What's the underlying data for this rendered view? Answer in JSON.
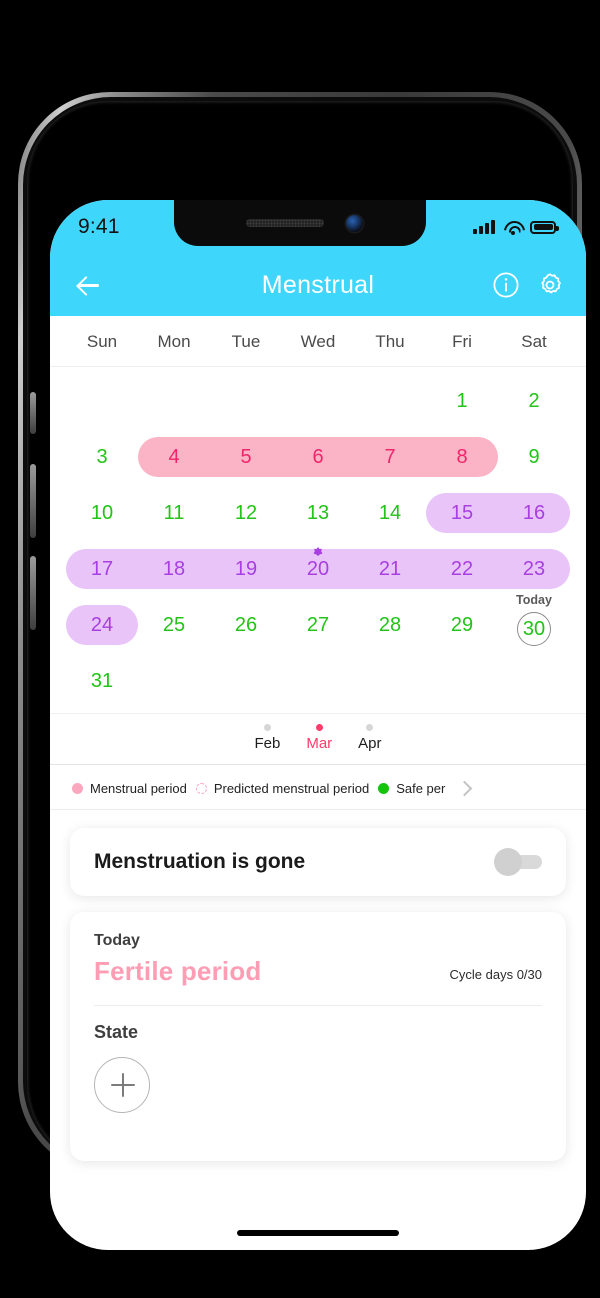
{
  "status_bar": {
    "time": "9:41",
    "signal_icon": "cellular-bars-icon",
    "wifi_icon": "wifi-icon",
    "battery_icon": "battery-icon"
  },
  "header": {
    "title": "Menstrual",
    "back_icon": "back-arrow-icon",
    "info_icon": "info-circle-icon",
    "settings_icon": "gear-icon",
    "background_color": "#3ED7FB"
  },
  "calendar": {
    "weekdays": [
      "Sun",
      "Mon",
      "Tue",
      "Wed",
      "Thu",
      "Fri",
      "Sat"
    ],
    "today_label": "Today",
    "weeks": [
      [
        {
          "day": "",
          "type": "empty"
        },
        {
          "day": "",
          "type": "empty"
        },
        {
          "day": "",
          "type": "empty"
        },
        {
          "day": "",
          "type": "empty"
        },
        {
          "day": "",
          "type": "empty"
        },
        {
          "day": "1",
          "type": "safe"
        },
        {
          "day": "2",
          "type": "safe"
        }
      ],
      [
        {
          "day": "3",
          "type": "safe"
        },
        {
          "day": "4",
          "type": "menses"
        },
        {
          "day": "5",
          "type": "menses"
        },
        {
          "day": "6",
          "type": "menses"
        },
        {
          "day": "7",
          "type": "menses"
        },
        {
          "day": "8",
          "type": "menses"
        },
        {
          "day": "9",
          "type": "safe"
        }
      ],
      [
        {
          "day": "10",
          "type": "safe"
        },
        {
          "day": "11",
          "type": "safe"
        },
        {
          "day": "12",
          "type": "safe"
        },
        {
          "day": "13",
          "type": "safe"
        },
        {
          "day": "14",
          "type": "safe"
        },
        {
          "day": "15",
          "type": "fertile"
        },
        {
          "day": "16",
          "type": "fertile"
        }
      ],
      [
        {
          "day": "17",
          "type": "fertile"
        },
        {
          "day": "18",
          "type": "fertile"
        },
        {
          "day": "19",
          "type": "fertile"
        },
        {
          "day": "20",
          "type": "fertile",
          "ovulation": true
        },
        {
          "day": "21",
          "type": "fertile"
        },
        {
          "day": "22",
          "type": "fertile"
        },
        {
          "day": "23",
          "type": "fertile"
        }
      ],
      [
        {
          "day": "24",
          "type": "fertile"
        },
        {
          "day": "25",
          "type": "safe"
        },
        {
          "day": "26",
          "type": "safe"
        },
        {
          "day": "27",
          "type": "safe"
        },
        {
          "day": "28",
          "type": "safe"
        },
        {
          "day": "29",
          "type": "safe"
        },
        {
          "day": "30",
          "type": "safe",
          "today": true
        }
      ],
      [
        {
          "day": "31",
          "type": "safe"
        },
        {
          "day": "",
          "type": "empty"
        },
        {
          "day": "",
          "type": "empty"
        },
        {
          "day": "",
          "type": "empty"
        },
        {
          "day": "",
          "type": "empty"
        },
        {
          "day": "",
          "type": "empty"
        },
        {
          "day": "",
          "type": "empty"
        }
      ]
    ],
    "colors": {
      "safe_day_text": "#22C417",
      "menses_day_text": "#F0256B",
      "menses_pill": "#FBB4C6",
      "fertile_day_text": "#A83FE0",
      "fertile_pill": "#E8C4F8"
    }
  },
  "months": [
    {
      "label": "Feb",
      "active": false
    },
    {
      "label": "Mar",
      "active": true
    },
    {
      "label": "Apr",
      "active": false
    }
  ],
  "legend": {
    "items": [
      {
        "label": "Menstrual period",
        "swatch": "filled-pink"
      },
      {
        "label": "Predicted menstrual period",
        "swatch": "dashed-pink"
      },
      {
        "label": "Safe per",
        "swatch": "green"
      }
    ],
    "more_icon": "chevron-right-icon"
  },
  "toggle_card": {
    "label": "Menstruation is gone",
    "state": "off"
  },
  "status_card": {
    "today_label": "Today",
    "status_title": "Fertile period",
    "status_color": "#FE9DB4",
    "cycle_label": "Cycle days",
    "cycle_value": "0/30",
    "state_label": "State",
    "add_icon": "plus-icon"
  }
}
